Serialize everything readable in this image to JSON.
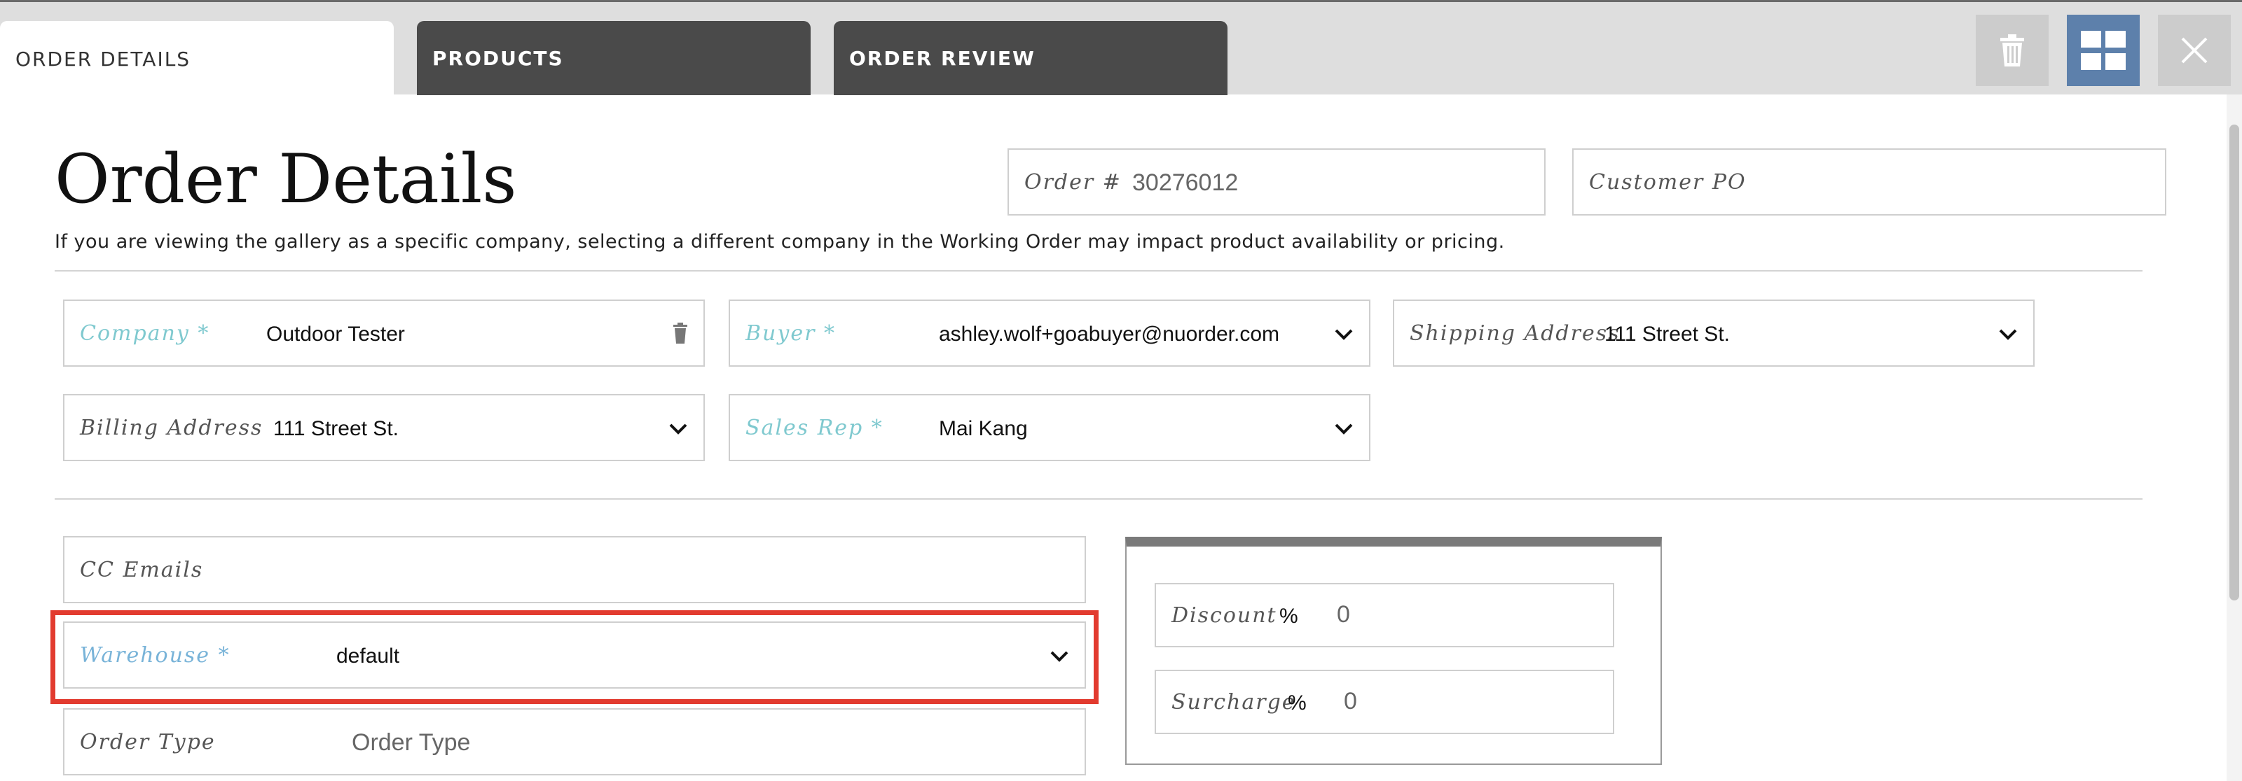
{
  "tabs": [
    {
      "label": "ORDER DETAILS",
      "active": true
    },
    {
      "label": "PRODUCTS",
      "active": false
    },
    {
      "label": "ORDER REVIEW",
      "active": false
    }
  ],
  "toolbar": {
    "trash_icon": "trash-icon",
    "grid_icon": "grid-icon",
    "close_icon": "close-icon"
  },
  "page": {
    "title": "Order Details",
    "notice": "If you are viewing the gallery as a specific company, selecting a different company in the Working Order may impact product availability or pricing."
  },
  "header_fields": {
    "order_number": {
      "label": "Order #",
      "value": "30276012"
    },
    "customer_po": {
      "label": "Customer PO",
      "value": ""
    }
  },
  "fields": {
    "company": {
      "label": "Company *",
      "value": "Outdoor Tester"
    },
    "buyer": {
      "label": "Buyer *",
      "value": "ashley.wolf+goabuyer@nuorder.com"
    },
    "shipping_address": {
      "label": "Shipping Address",
      "value": "111 Street St."
    },
    "billing_address": {
      "label": "Billing Address",
      "value": "111 Street St."
    },
    "sales_rep": {
      "label": "Sales Rep *",
      "value": "Mai Kang"
    },
    "cc_emails": {
      "label": "CC Emails",
      "value": ""
    },
    "warehouse": {
      "label": "Warehouse *",
      "value": "default"
    },
    "order_type": {
      "label": "Order Type",
      "placeholder": "Order Type"
    }
  },
  "adjustments": {
    "discount": {
      "label": "Discount",
      "unit": "%",
      "value": "0"
    },
    "surcharge": {
      "label": "Surcharge",
      "unit": "%",
      "value": "0"
    }
  },
  "colors": {
    "required_label": "#7fc9cf",
    "highlight": "#e23b2f",
    "grid_button": "#5d80ab",
    "dark_tab": "#4a4a4a"
  }
}
